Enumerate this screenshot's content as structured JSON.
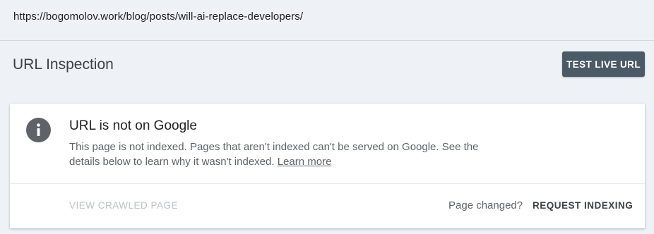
{
  "url_bar": {
    "url": "https://bogomolov.work/blog/posts/will-ai-replace-developers/"
  },
  "header": {
    "title": "URL Inspection",
    "test_live_url_label": "TEST LIVE URL"
  },
  "status_card": {
    "icon": "info-icon",
    "title": "URL is not on Google",
    "description": "This page is not indexed. Pages that aren't indexed can't be served on Google. See the details below to learn why it wasn't indexed.",
    "learn_more_label": "Learn more",
    "view_crawled_page_label": "VIEW CRAWLED PAGE",
    "page_changed_label": "Page changed?",
    "request_indexing_label": "REQUEST INDEXING"
  },
  "colors": {
    "background": "#eef1f6",
    "primary_button": "#4a5a66",
    "icon_gray": "#5f6368",
    "disabled_text": "#bdc1c6"
  }
}
